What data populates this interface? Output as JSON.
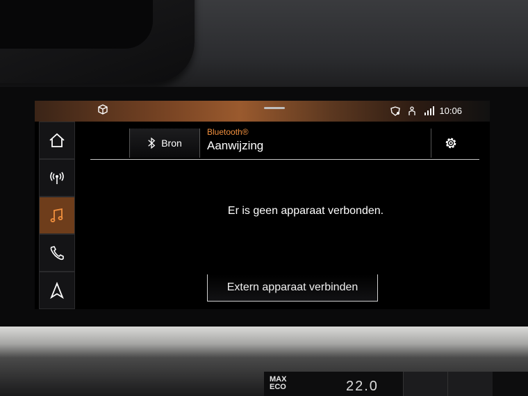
{
  "status_bar": {
    "clock": "10:06"
  },
  "rail": [
    {
      "icon": "home-icon"
    },
    {
      "icon": "radio-icon"
    },
    {
      "icon": "music-icon",
      "active": true
    },
    {
      "icon": "phone-icon"
    },
    {
      "icon": "navigation-icon"
    }
  ],
  "header": {
    "source_label": "Bron",
    "source_name": "Bluetooth®",
    "source_subtitle": "Aanwijzing"
  },
  "main": {
    "message": "Er is geen apparaat verbonden.",
    "connect_button": "Extern apparaat verbinden"
  },
  "climate": {
    "mode": "MAX\nECO",
    "temperature": "22.0"
  },
  "colors": {
    "accent": "#f2903e",
    "active_tab": "#6e3d1b"
  }
}
